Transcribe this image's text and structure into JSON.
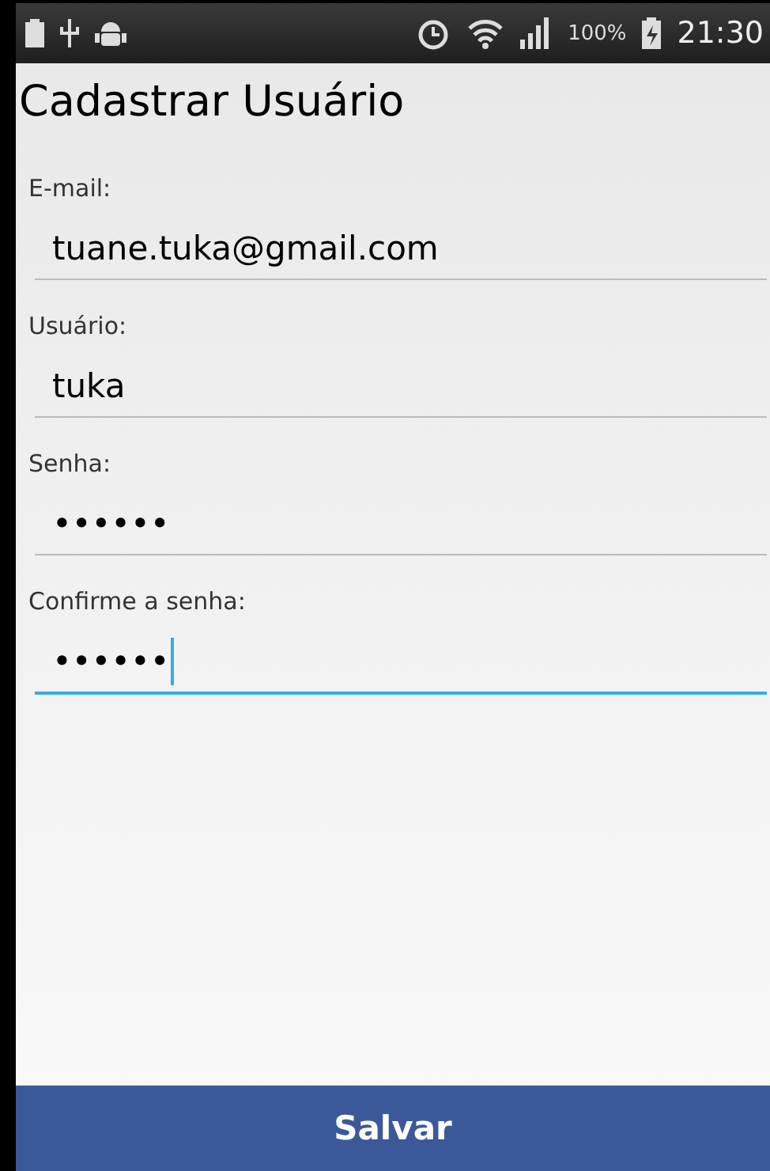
{
  "status_bar": {
    "battery_percent": "100%",
    "time": "21:30"
  },
  "title": "Cadastrar Usuário",
  "fields": [
    {
      "label": "E-mail:",
      "value": "tuane.tuka@gmail.com",
      "focused": false
    },
    {
      "label": "Usuário:",
      "value": "tuka",
      "focused": false
    },
    {
      "label": "Senha:",
      "value": "••••••",
      "focused": false
    },
    {
      "label": "Confirme a senha:",
      "value": "••••••",
      "focused": true
    }
  ],
  "button": "Salvar"
}
